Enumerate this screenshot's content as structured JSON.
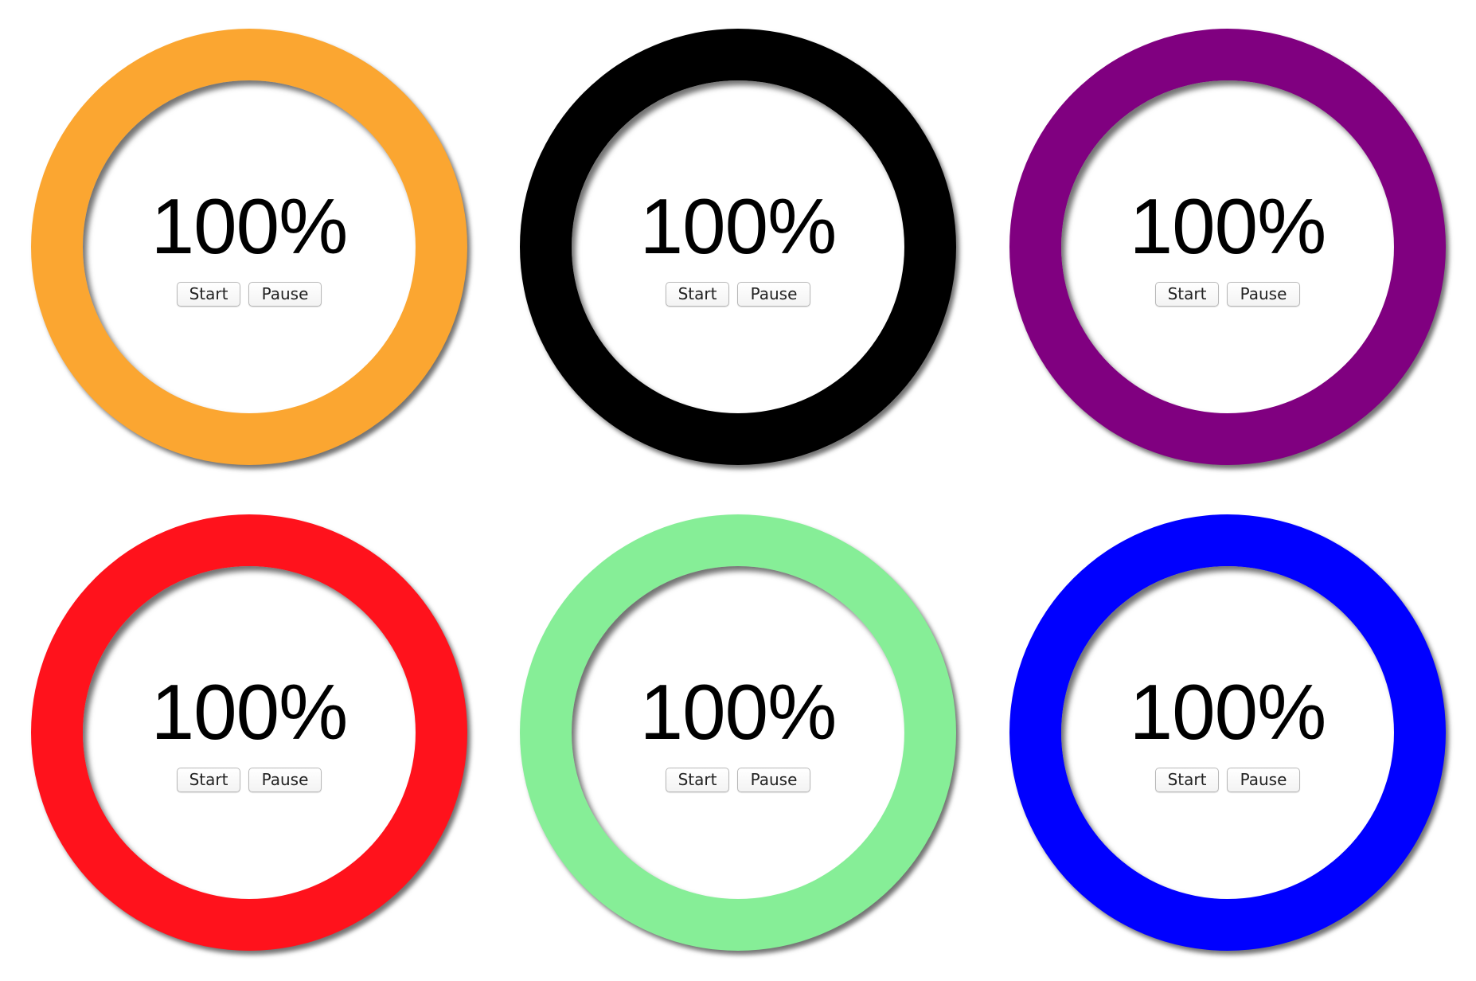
{
  "timers": [
    {
      "color": "#FBA631",
      "progress_label": "100%",
      "start_label": "Start",
      "pause_label": "Pause"
    },
    {
      "color": "#000000",
      "progress_label": "100%",
      "start_label": "Start",
      "pause_label": "Pause"
    },
    {
      "color": "#800080",
      "progress_label": "100%",
      "start_label": "Start",
      "pause_label": "Pause"
    },
    {
      "color": "#FF121C",
      "progress_label": "100%",
      "start_label": "Start",
      "pause_label": "Pause"
    },
    {
      "color": "#86EE97",
      "progress_label": "100%",
      "start_label": "Start",
      "pause_label": "Pause"
    },
    {
      "color": "#0000FF",
      "progress_label": "100%",
      "start_label": "Start",
      "pause_label": "Pause"
    }
  ]
}
